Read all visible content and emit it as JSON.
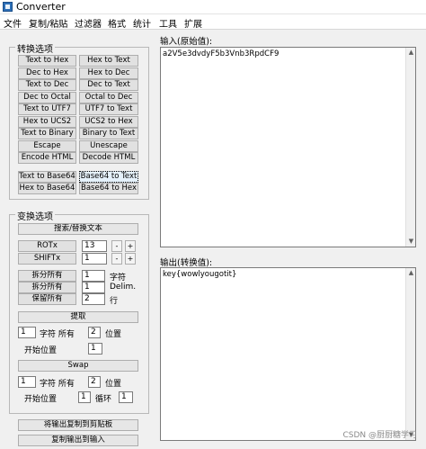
{
  "window": {
    "title": "Converter"
  },
  "menu": [
    "文件",
    "复制/粘贴",
    "过滤器",
    "格式",
    "统计",
    "工具",
    "扩展"
  ],
  "convert_group": {
    "title": "转换选项",
    "buttons": [
      "Text to Hex",
      "Hex to Text",
      "Dec to Hex",
      "Hex to Dec",
      "Text to Dec",
      "Dec to Text",
      "Dec to Octal",
      "Octal to Dec",
      "Text to UTF7",
      "UTF7 to Text",
      "Hex to UCS2",
      "UCS2 to Hex",
      "Text to Binary",
      "Binary to Text",
      "Escape",
      "Unescape",
      "Encode HTML",
      "Decode HTML"
    ],
    "base64_buttons": [
      "Text to Base64",
      "Base64 to Text",
      "Hex to Base64",
      "Base64 to Hex"
    ]
  },
  "transform_group": {
    "title": "变换选项",
    "search_replace": "搜索/替换文本",
    "rot_label": "ROTx",
    "rot_value": "13",
    "shift_label": "SHIFTx",
    "shift_value": "1",
    "minus": "-",
    "plus": "+",
    "split_all_1": "拆分所有",
    "split_all_1_value": "1",
    "split_all_1_unit": "字符",
    "split_all_2": "拆分所有",
    "split_all_2_value": "1",
    "split_all_2_unit": "Delim.",
    "keep_all": "保留所有",
    "keep_all_value": "2",
    "keep_all_unit": "行",
    "extract": "提取",
    "extract_count": "1",
    "extract_chars_all": "字符 所有",
    "extract_pos": "2",
    "extract_pos_label": "位置",
    "start_pos_label": "开始位置",
    "start_pos_value": "1",
    "swap": "Swap",
    "swap_count": "1",
    "swap_chars_all": "字符 所有",
    "swap_pos": "2",
    "swap_pos_label": "位置",
    "swap_start_label": "开始位置",
    "swap_start_value": "1",
    "loop_label": "循环",
    "loop_value": "1"
  },
  "bottom_buttons": {
    "copy_output": "将输出复制到剪贴板",
    "copy_to_input": "复制输出到输入"
  },
  "input": {
    "label": "输入(原始值):",
    "value": "a2V5e3dvdyF5b3Vnb3RpdCF9"
  },
  "output": {
    "label": "输出(转换值):",
    "value": "key{wowlyougotit}"
  },
  "watermark": "CSDN @厨厨糖学习"
}
